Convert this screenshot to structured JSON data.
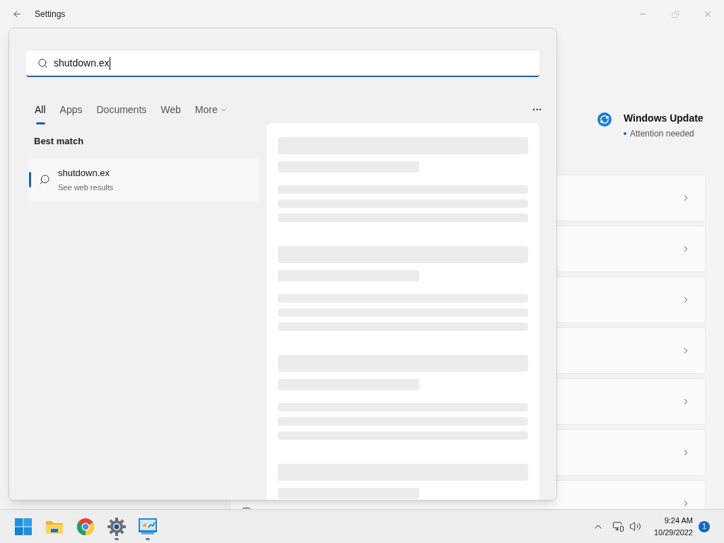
{
  "window": {
    "title": "Settings"
  },
  "windows_update": {
    "title": "Windows Update",
    "status": "Attention needed"
  },
  "search": {
    "value": "shutdown.ex"
  },
  "tabs": [
    {
      "label": "All",
      "selected": true
    },
    {
      "label": "Apps",
      "selected": false
    },
    {
      "label": "Documents",
      "selected": false
    },
    {
      "label": "Web",
      "selected": false
    },
    {
      "label": "More",
      "selected": false,
      "kind": "dropdown"
    }
  ],
  "more_options": "···",
  "best_match": {
    "heading": "Best match",
    "results": [
      {
        "title": "shutdown.ex",
        "subtitle": "See web results",
        "selected": true
      }
    ]
  },
  "taskbar": {
    "apps": [
      {
        "kind": "start",
        "running": false
      },
      {
        "kind": "folder",
        "running": false
      },
      {
        "kind": "browser",
        "running": false
      },
      {
        "kind": "settings",
        "running": true
      },
      {
        "kind": "monitor",
        "running": true
      }
    ],
    "time": "9:24 AM",
    "date": "10/29/2022",
    "notifications": "1"
  }
}
